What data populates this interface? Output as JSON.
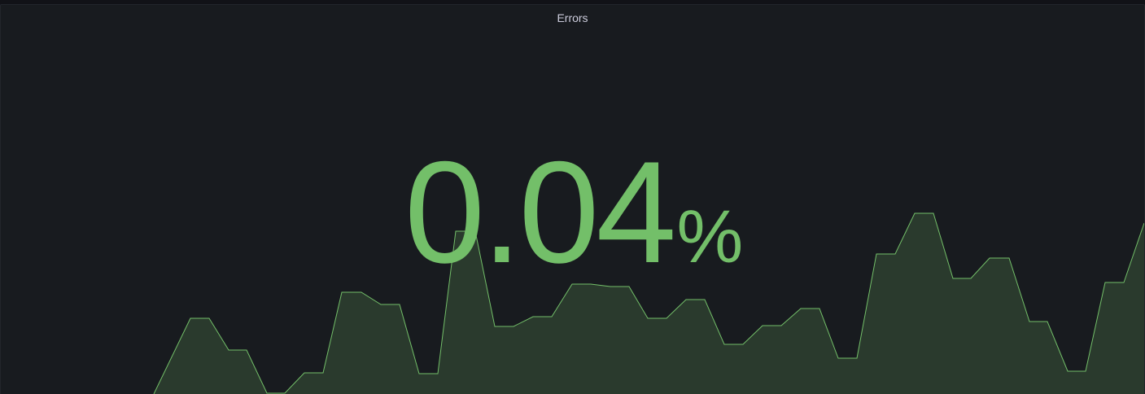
{
  "panel": {
    "title": "Errors",
    "value": "0.04",
    "unit": "%",
    "color": "#73bf69",
    "fill_color": "#2a3a2d"
  },
  "chart_data": {
    "type": "area",
    "values": [
      0.0,
      0.023,
      0.016,
      0.0,
      0.006,
      0.03,
      0.028,
      0.01,
      0.05,
      0.02,
      0.022,
      0.034,
      0.033,
      0.023,
      0.029,
      0.013,
      0.02,
      0.025,
      0.009,
      0.039,
      0.048,
      0.034,
      0.042,
      0.02,
      0.006,
      0.034,
      0.052
    ]
  }
}
